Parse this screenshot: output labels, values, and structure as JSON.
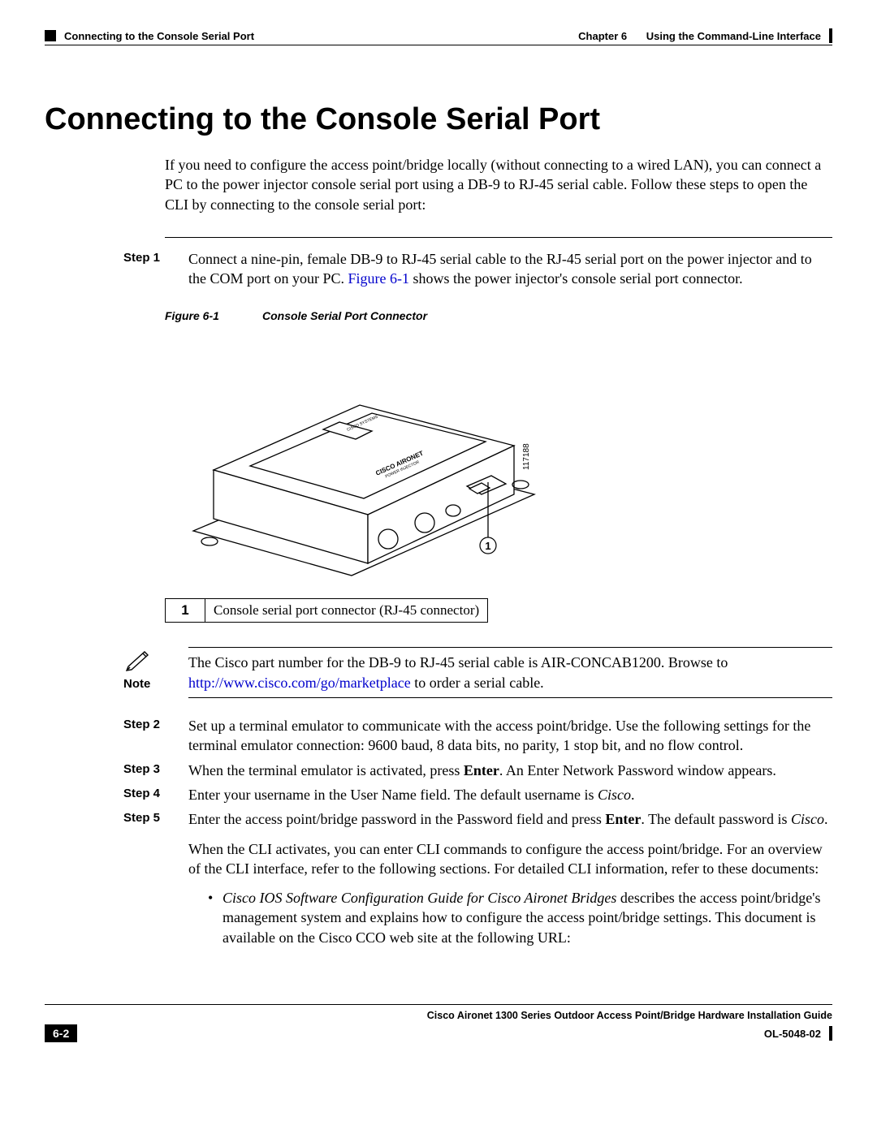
{
  "header": {
    "section": "Connecting to the Console Serial Port",
    "chapter_label": "Chapter 6",
    "chapter_title": "Using the Command-Line Interface"
  },
  "title": "Connecting to the Console Serial Port",
  "intro": "If you need to configure the access point/bridge locally (without connecting to a wired LAN), you can connect a PC to the power injector console serial port using a DB-9 to RJ-45 serial cable. Follow these steps to open the CLI by connecting to the console serial port:",
  "step1": {
    "label": "Step 1",
    "text_a": "Connect a nine-pin, female DB-9 to RJ-45 serial cable to the RJ-45 serial port on the power injector and to the COM port on your PC. ",
    "link": "Figure 6-1",
    "text_b": " shows the power injector's console serial port connector."
  },
  "figure": {
    "num": "Figure 6-1",
    "title": "Console Serial Port Connector",
    "device_brand": "CISCO SYSTEMS",
    "device_model": "CISCO AIRONET",
    "device_sub": "POWER INJECTOR",
    "callout_num": "1",
    "side_id": "117188"
  },
  "legend": {
    "num": "1",
    "desc": "Console serial port connector (RJ-45 connector)"
  },
  "note": {
    "label": "Note",
    "text_a": "The Cisco part number for the DB-9 to RJ-45 serial cable is AIR-CONCAB1200. Browse to ",
    "link": "http://www.cisco.com/go/marketplace",
    "text_b": " to order a serial cable."
  },
  "step2": {
    "label": "Step 2",
    "text": "Set up a terminal emulator to communicate with the access point/bridge. Use the following settings for the terminal emulator connection: 9600 baud, 8 data bits, no parity, 1 stop bit, and no flow control."
  },
  "step3": {
    "label": "Step 3",
    "text_a": "When the terminal emulator is activated, press ",
    "bold": "Enter",
    "text_b": ". An Enter Network Password window appears."
  },
  "step4": {
    "label": "Step 4",
    "text_a": "Enter your username in the User Name field. The default username is ",
    "italic": "Cisco",
    "text_b": "."
  },
  "step5": {
    "label": "Step 5",
    "text_a": "Enter the access point/bridge password in the Password field and press ",
    "bold": "Enter",
    "text_b": ". The default password is ",
    "italic": "Cisco",
    "text_c": "."
  },
  "cont": "When the CLI activates, you can enter CLI commands to configure the access point/bridge. For an overview of the CLI interface, refer to the following sections. For detailed CLI information, refer to these documents:",
  "bullet1": {
    "italic": "Cisco IOS Software Configuration Guide for Cisco Aironet Bridges",
    "text": " describes the access point/bridge's management system and explains how to configure the access point/bridge settings. This document is available on the Cisco CCO web site at the following URL:"
  },
  "footer": {
    "guide": "Cisco Aironet 1300 Series Outdoor Access Point/Bridge Hardware Installation Guide",
    "page": "6-2",
    "doc": "OL-5048-02"
  }
}
